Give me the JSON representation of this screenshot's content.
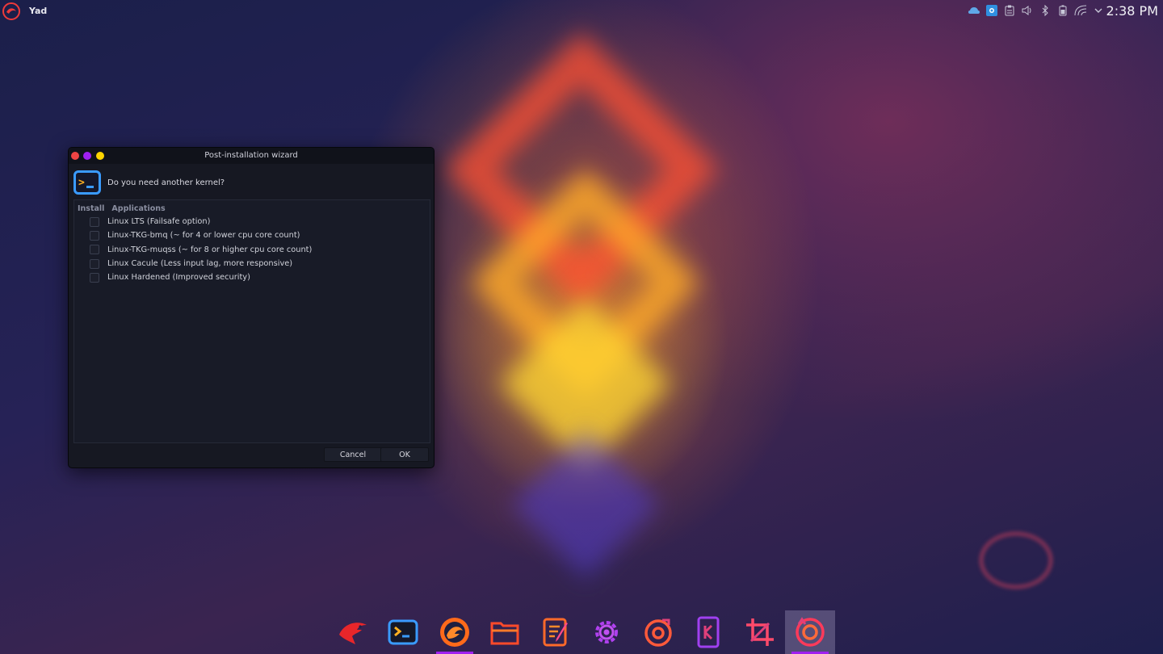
{
  "top_bar": {
    "app_name": "Yad",
    "clock": "2:38 PM",
    "tray_icons": [
      "weather-icon",
      "screenshot-tool-icon",
      "clipboard-icon",
      "volume-icon",
      "bluetooth-icon",
      "battery-icon",
      "wifi-icon",
      "chevron-down-icon"
    ]
  },
  "dialog": {
    "title": "Post-installation wizard",
    "question": "Do you need another kernel?",
    "columns": [
      "Install",
      "Applications"
    ],
    "items": [
      {
        "label": "Linux LTS (Failsafe option)",
        "checked": false
      },
      {
        "label": "Linux-TKG-bmq (~ for 4 or lower cpu core count)",
        "checked": false
      },
      {
        "label": "Linux-TKG-muqss (~ for 8 or higher cpu core count)",
        "checked": false
      },
      {
        "label": "Linux Cacule (Less input lag, more responsive)",
        "checked": false
      },
      {
        "label": "Linux Hardened (Improved security)",
        "checked": false
      }
    ],
    "buttons": {
      "cancel": "Cancel",
      "ok": "OK"
    }
  },
  "dock": {
    "items": [
      "garuda-logo-icon",
      "terminal-icon",
      "firedragon-browser-icon",
      "file-manager-icon",
      "text-editor-icon",
      "settings-icon",
      "music-player-icon",
      "kde-connect-icon",
      "crop-tool-icon",
      "restore-tool-icon"
    ],
    "colors": {
      "accent": "#a020f0",
      "orange": "#ff6a1a",
      "pink": "#e0407a",
      "purple": "#b040f0",
      "blue": "#3a9bff"
    }
  }
}
